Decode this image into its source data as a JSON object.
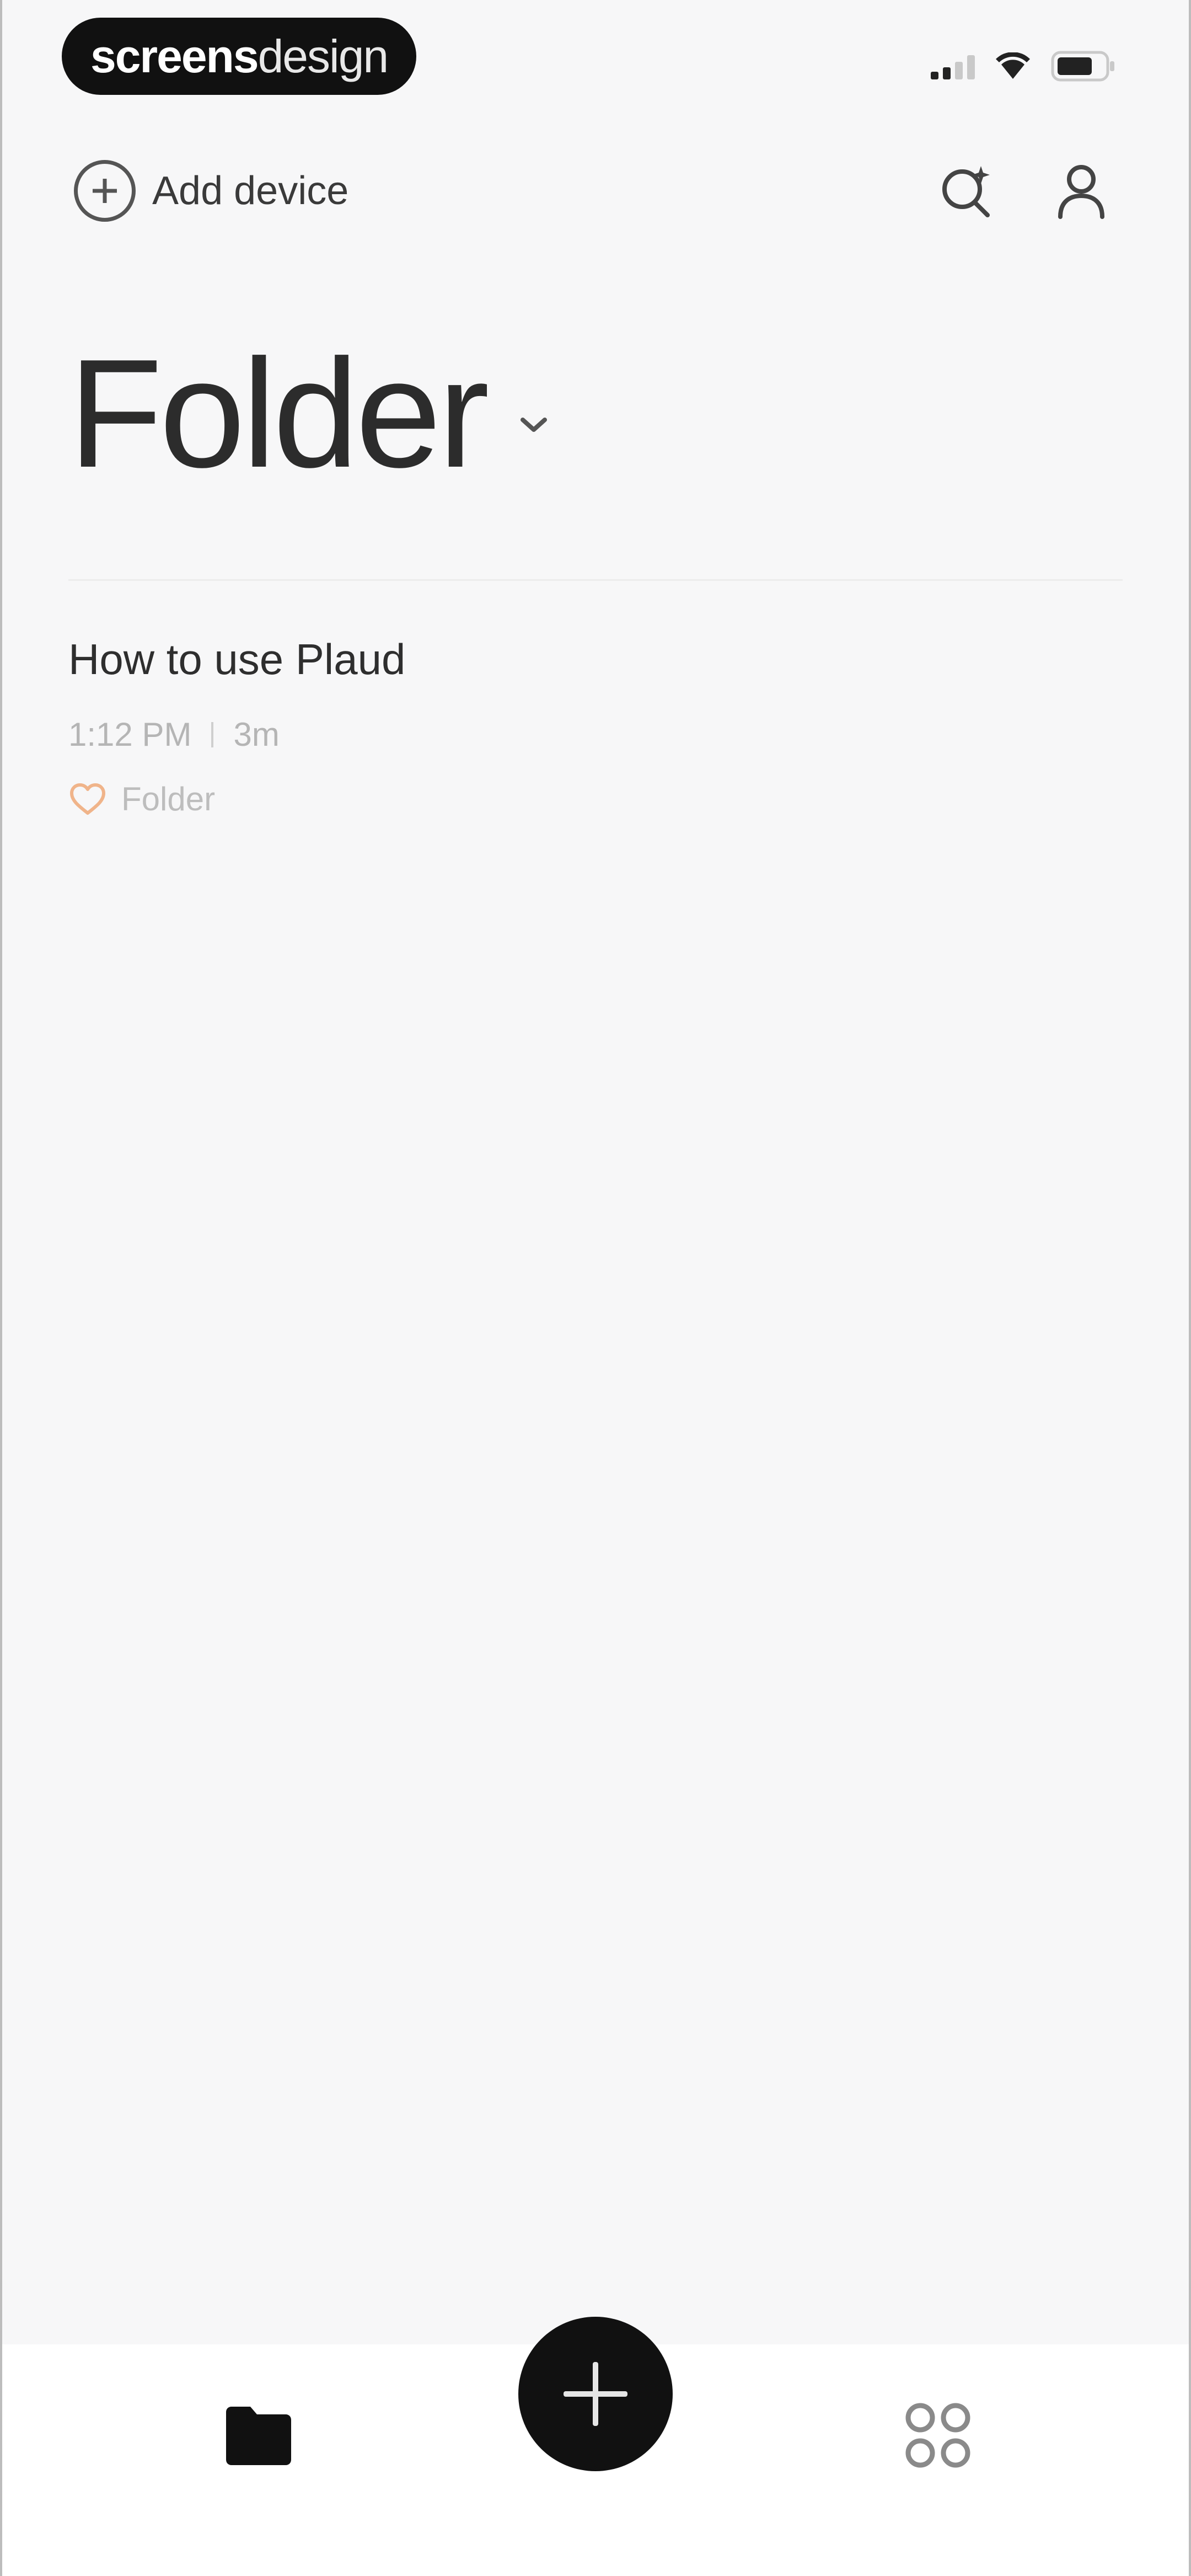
{
  "status_bar": {
    "brand_bold": "screens",
    "brand_light": "design"
  },
  "header": {
    "add_device_label": "Add device",
    "icons": [
      "add-circle-icon",
      "search-sparkle-icon",
      "profile-icon"
    ]
  },
  "page": {
    "title": "Folder"
  },
  "recordings": [
    {
      "title": "How to use Plaud",
      "time": "1:12 PM",
      "duration": "3m",
      "folder": "Folder"
    }
  ],
  "bottom_nav": {
    "icons": [
      "folder-icon",
      "add-icon",
      "apps-grid-icon"
    ]
  },
  "colors": {
    "background": "#f7f7f8",
    "fab": "#111111",
    "tag_heart": "#f0b48a"
  }
}
